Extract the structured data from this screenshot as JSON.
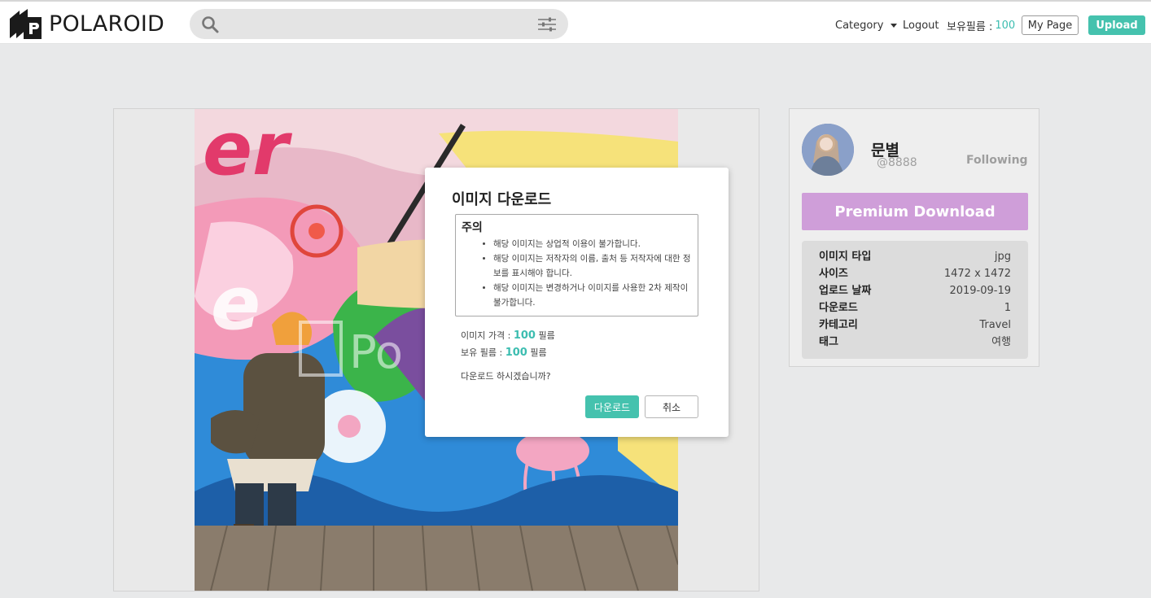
{
  "header": {
    "logo_text": "POLAROID",
    "search_placeholder": "",
    "category_label": "Category",
    "logout_label": "Logout",
    "films_label": "보유필름 :",
    "films_count": "100",
    "mypage_label": "My Page",
    "upload_label": "Upload"
  },
  "profile": {
    "name": "문별",
    "handle": "@8888",
    "follow_label": "Following",
    "premium_label": "Premium Download"
  },
  "image_info": [
    {
      "label": "이미지 타입",
      "value": "jpg"
    },
    {
      "label": "사이즈",
      "value": "1472 x 1472"
    },
    {
      "label": "업로드 날짜",
      "value": "2019-09-19"
    },
    {
      "label": "다운로드",
      "value": "1"
    },
    {
      "label": "카테고리",
      "value": "Travel"
    },
    {
      "label": "태그",
      "value": "여행"
    }
  ],
  "modal": {
    "title": "이미지 다운로드",
    "notice_title": "주의",
    "notices": [
      "해당 이미지는 상업적 이용이 불가합니다.",
      "해당 이미지는 저작자의 이름, 출처 등 저작자에 대한 정보를 표시해야 합니다.",
      "해당 이미지는 변경하거나 이미지를 사용한 2차 제작이 불가합니다."
    ],
    "price_label": "이미지 가격 :",
    "price_value": "100",
    "price_unit": "필름",
    "owned_label": "보유 필름 :",
    "owned_value": "100",
    "owned_unit": "필름",
    "confirm_text": "다운로드 하시겠습니까?",
    "download_label": "다운로드",
    "cancel_label": "취소"
  },
  "watermark_text": "Po",
  "colors": {
    "accent": "#45c2ae",
    "premium": "#cf9ed9"
  }
}
